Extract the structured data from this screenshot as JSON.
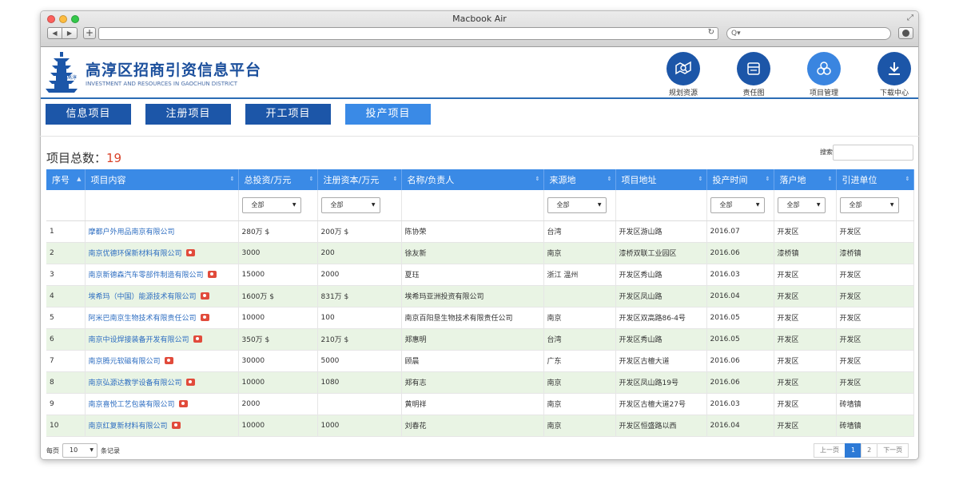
{
  "window": {
    "title": "Macbook Air"
  },
  "brand": {
    "title": "高淳区招商引资信息平台",
    "subtitle": "INVESTMENT AND RESOURCES IN GAOCHUN DISTRICT"
  },
  "top_nav": [
    {
      "label": "规划资源",
      "icon": "map-search-icon"
    },
    {
      "label": "责任图",
      "icon": "book-icon"
    },
    {
      "label": "项目管理",
      "icon": "cubes-icon",
      "active": true
    },
    {
      "label": "下载中心",
      "icon": "download-icon"
    }
  ],
  "tabs": [
    {
      "label": "信息项目"
    },
    {
      "label": "注册项目"
    },
    {
      "label": "开工项目"
    },
    {
      "label": "投产项目",
      "active": true
    }
  ],
  "summary": {
    "label": "项目总数：",
    "count": "19"
  },
  "search": {
    "label": "搜索"
  },
  "table": {
    "columns": [
      "序号",
      "项目内容",
      "总投资/万元",
      "注册资本/万元",
      "名称/负责人",
      "来源地",
      "项目地址",
      "投产时间",
      "落户地",
      "引进单位"
    ],
    "filter_all": "全部",
    "rows": [
      [
        "1",
        "摩都户外用品南京有限公司",
        "280万 $",
        "200万 $",
        "陈协荣",
        "台湾",
        "开发区游山路",
        "2016.07",
        "开发区",
        "开发区"
      ],
      [
        "2",
        "南京优德环保新材料有限公司",
        "3000",
        "200",
        "徐友新",
        "南京",
        "漆桥双联工业园区",
        "2016.06",
        "漆桥镇",
        "漆桥镇"
      ],
      [
        "3",
        "南京新德森汽车零部件制造有限公司",
        "15000",
        "2000",
        "夏珏",
        "浙江 温州",
        "开发区秀山路",
        "2016.03",
        "开发区",
        "开发区"
      ],
      [
        "4",
        "埃希玛（中国）能源技术有限公司",
        "1600万 $",
        "831万 $",
        "埃希玛亚洲投资有限公司",
        "",
        "开发区凤山路",
        "2016.04",
        "开发区",
        "开发区"
      ],
      [
        "5",
        "阿米巴南京生物技术有限责任公司",
        "10000",
        "100",
        "南京百阳垦生物技术有限责任公司",
        "南京",
        "开发区双高路86-4号",
        "2016.05",
        "开发区",
        "开发区"
      ],
      [
        "6",
        "南京中设焊接装备开发有限公司",
        "350万 $",
        "210万 $",
        "郑惠明",
        "台湾",
        "开发区秀山路",
        "2016.05",
        "开发区",
        "开发区"
      ],
      [
        "7",
        "南京腾元软磁有限公司",
        "30000",
        "5000",
        "顾晨",
        "广东",
        "开发区古檀大道",
        "2016.06",
        "开发区",
        "开发区"
      ],
      [
        "8",
        "南京弘源达教学设备有限公司",
        "10000",
        "1080",
        "郑有志",
        "南京",
        "开发区凤山路19号",
        "2016.06",
        "开发区",
        "开发区"
      ],
      [
        "9",
        "南京喜悦工艺包装有限公司",
        "2000",
        "",
        "黄明祥",
        "南京",
        "开发区古檀大道27号",
        "2016.03",
        "开发区",
        "砖墙镇"
      ],
      [
        "10",
        "南京红复新材料有限公司",
        "10000",
        "1000",
        "刘春花",
        "南京",
        "开发区恒盛路以西",
        "2016.04",
        "开发区",
        "砖墙镇"
      ]
    ]
  },
  "pagination": {
    "per_page_label": "每页",
    "per_page": "10",
    "records_label": "条记录",
    "prev": "上一页",
    "pages": [
      "1",
      "2"
    ],
    "current": "1",
    "next": "下一页"
  },
  "colors": {
    "primary": "#1c56a8",
    "accent": "#3a8ae6",
    "row_alt": "#e9f4e4",
    "count": "#d9432a"
  }
}
